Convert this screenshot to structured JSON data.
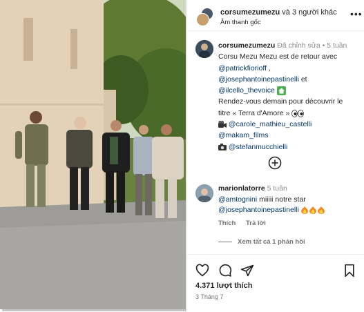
{
  "media": {
    "progress_fraction": 0.01,
    "colors": {
      "wall": "#e4d2b8",
      "road": "#9d9c98",
      "foliage": "#4a6a2a"
    }
  },
  "header": {
    "username": "corsumezumezu",
    "collaborators": "và 3 người khác",
    "subtitle": "Âm thanh gốc",
    "more_icon": "more-horizontal-icon"
  },
  "caption": {
    "username": "corsumezumezu",
    "edited": "Đã chỉnh sửa",
    "time": "5 tuần",
    "line1": "Corsu Mezu Mezu est de retour avec",
    "mention1": "@patrickfiorioff",
    "mention1_suffix": " ,",
    "mention2": "@josephantoinepastinelli",
    "mention2_suffix": " et",
    "mention3": "@ilcello_thevoice",
    "line2": "Rendez-vous demain pour découvrir le",
    "line3": "titre « Terra d'Amore »",
    "mention4": "@carole_mathieu_castelli",
    "mention5": "@makam_films",
    "mention6": "@stefanmucchielli"
  },
  "comment": {
    "username": "marionlatorre",
    "time": "5 tuần",
    "mention1": "@amtognini",
    "text1": " miiiii notre star",
    "mention2": "@josephantoinepastinelli",
    "like_label": "Thích",
    "reply_label": "Trả lời",
    "view_replies": "Xem tất cả 1 phản hồi"
  },
  "actions": {
    "icons": [
      "heart-icon",
      "comment-icon",
      "share-icon",
      "bookmark-icon"
    ],
    "likes": "4.371 lượt thích",
    "date": "3 Tháng 7"
  },
  "colors": {
    "mention": "#00376b",
    "muted": "#8e8e8e",
    "fire": "#f08a24",
    "emoji_green": "#4caf50"
  }
}
